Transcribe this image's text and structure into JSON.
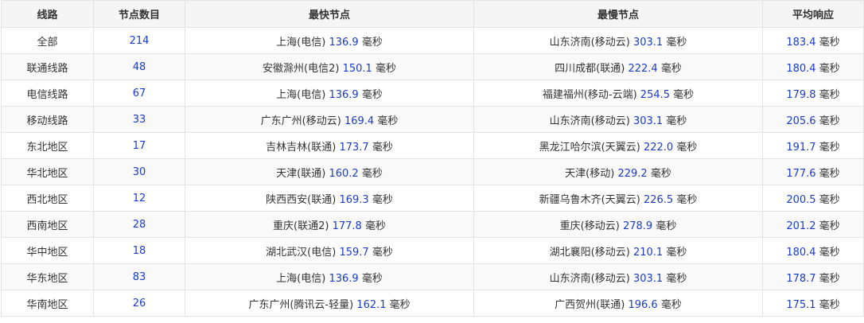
{
  "table": {
    "headers": [
      "线路",
      "节点数目",
      "最快节点",
      "最慢节点",
      "平均响应"
    ],
    "unit": "毫秒",
    "rows": [
      {
        "line": "全部",
        "count": "214",
        "fast_name": "上海(电信)",
        "fast_val": "136.9",
        "slow_name": "山东济南(移动云)",
        "slow_val": "303.1",
        "avg": "183.4"
      },
      {
        "line": "联通线路",
        "count": "48",
        "fast_name": "安徽滁州(电信2)",
        "fast_val": "150.1",
        "slow_name": "四川成都(联通)",
        "slow_val": "222.4",
        "avg": "180.4"
      },
      {
        "line": "电信线路",
        "count": "67",
        "fast_name": "上海(电信)",
        "fast_val": "136.9",
        "slow_name": "福建福州(移动-云端)",
        "slow_val": "254.5",
        "avg": "179.8"
      },
      {
        "line": "移动线路",
        "count": "33",
        "fast_name": "广东广州(移动云)",
        "fast_val": "169.4",
        "slow_name": "山东济南(移动云)",
        "slow_val": "303.1",
        "avg": "205.6"
      },
      {
        "line": "东北地区",
        "count": "17",
        "fast_name": "吉林吉林(联通)",
        "fast_val": "173.7",
        "slow_name": "黑龙江哈尔滨(天翼云)",
        "slow_val": "222.0",
        "avg": "191.7"
      },
      {
        "line": "华北地区",
        "count": "30",
        "fast_name": "天津(联通)",
        "fast_val": "160.2",
        "slow_name": "天津(移动)",
        "slow_val": "229.2",
        "avg": "177.6"
      },
      {
        "line": "西北地区",
        "count": "12",
        "fast_name": "陕西西安(联通)",
        "fast_val": "169.3",
        "slow_name": "新疆乌鲁木齐(天翼云)",
        "slow_val": "226.5",
        "avg": "200.5"
      },
      {
        "line": "西南地区",
        "count": "28",
        "fast_name": "重庆(联通2)",
        "fast_val": "177.8",
        "slow_name": "重庆(移动云)",
        "slow_val": "278.9",
        "avg": "201.2"
      },
      {
        "line": "华中地区",
        "count": "18",
        "fast_name": "湖北武汉(电信)",
        "fast_val": "159.7",
        "slow_name": "湖北襄阳(移动云)",
        "slow_val": "210.1",
        "avg": "180.4"
      },
      {
        "line": "华东地区",
        "count": "83",
        "fast_name": "上海(电信)",
        "fast_val": "136.9",
        "slow_name": "山东济南(移动云)",
        "slow_val": "303.1",
        "avg": "178.7"
      },
      {
        "line": "华南地区",
        "count": "26",
        "fast_name": "广东广州(腾讯云-轻量)",
        "fast_val": "162.1",
        "slow_name": "广西贺州(联通)",
        "slow_val": "196.6",
        "avg": "175.1"
      }
    ]
  },
  "colors": {
    "number": "#1a3cc8",
    "header_bg": "#f5f5f5",
    "border": "#e3e3e3"
  }
}
